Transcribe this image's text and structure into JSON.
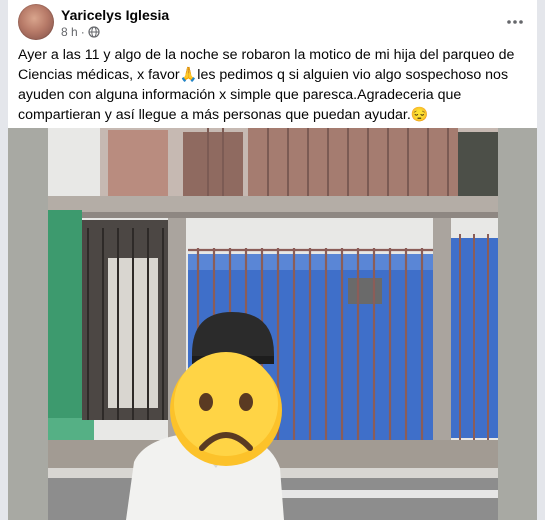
{
  "post": {
    "author": "Yaricelys Iglesia",
    "time": "8 h",
    "separator": "·",
    "text": "Ayer a las 11 y algo de la noche se robaron la motico de mi hija del parqueo de Ciencias médicas, x favor🙏les pedimos q si alguien vio algo sospechoso nos ayuden con alguna información x simple que paresca.Agradeceria que compartieran y así llegue a más personas que puedan ayudar.😔"
  },
  "icons": {
    "privacy": "globe-icon",
    "menu": "more-options-icon",
    "face": "sad-face-emoji-icon"
  },
  "colors": {
    "name": "#050505",
    "meta": "#65676b",
    "shutter": "#3f6fc9",
    "wall_green": "#3d9a6e"
  }
}
